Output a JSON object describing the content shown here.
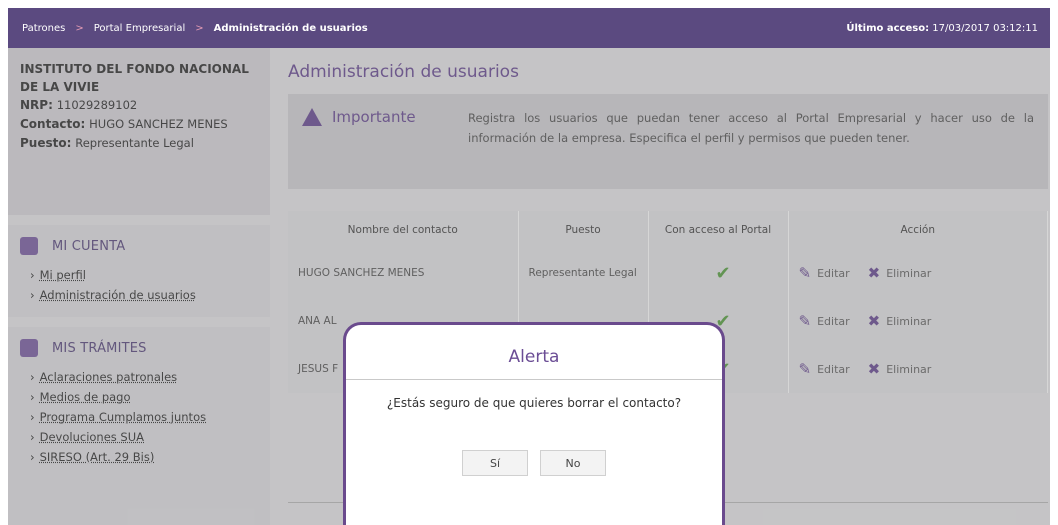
{
  "breadcrumb": [
    "Patrones",
    "Portal Empresarial",
    "Administración de usuarios"
  ],
  "last_access": {
    "label": "Último acceso:",
    "value": "17/03/2017 03:12:11"
  },
  "profile": {
    "institution": "INSTITUTO DEL FONDO NACIONAL DE LA VIVIE",
    "nrp_label": "NRP:",
    "nrp": "11029289102",
    "contact_label": "Contacto:",
    "contact": "HUGO SANCHEZ MENES",
    "role_label": "Puesto:",
    "role": "Representante Legal"
  },
  "mi_cuenta": {
    "title": "MI CUENTA",
    "items": [
      "Mi perfil",
      "Administración de usuarios"
    ]
  },
  "mis_tramites": {
    "title": "MIS TRÁMITES",
    "items": [
      "Aclaraciones patronales",
      "Medios de pago",
      "Programa Cumplamos juntos",
      "Devoluciones SUA",
      "SIRESO (Art. 29 Bis)"
    ]
  },
  "main": {
    "title": "Administración de usuarios",
    "notice_label": "Importante",
    "notice_text": "Registra los usuarios que puedan tener acceso al Portal Empresarial y hacer uso de la información de la empresa. Especifica el perfil y permisos que pueden tener."
  },
  "table": {
    "headers": [
      "Nombre del contacto",
      "Puesto",
      "Con acceso al Portal",
      "Acción"
    ],
    "rows": [
      {
        "name": "HUGO SANCHEZ MENES",
        "role": "Representante Legal",
        "access": "✔"
      },
      {
        "name": "ANA AL",
        "role": "",
        "access": "✔"
      },
      {
        "name": "JESUS F",
        "role": "",
        "access": "✔"
      }
    ],
    "edit_label": "Editar",
    "delete_label": "Eliminar"
  },
  "modal": {
    "title": "Alerta",
    "message": "¿Estás seguro de que quieres borrar el contacto?",
    "yes": "Sí",
    "no": "No"
  }
}
